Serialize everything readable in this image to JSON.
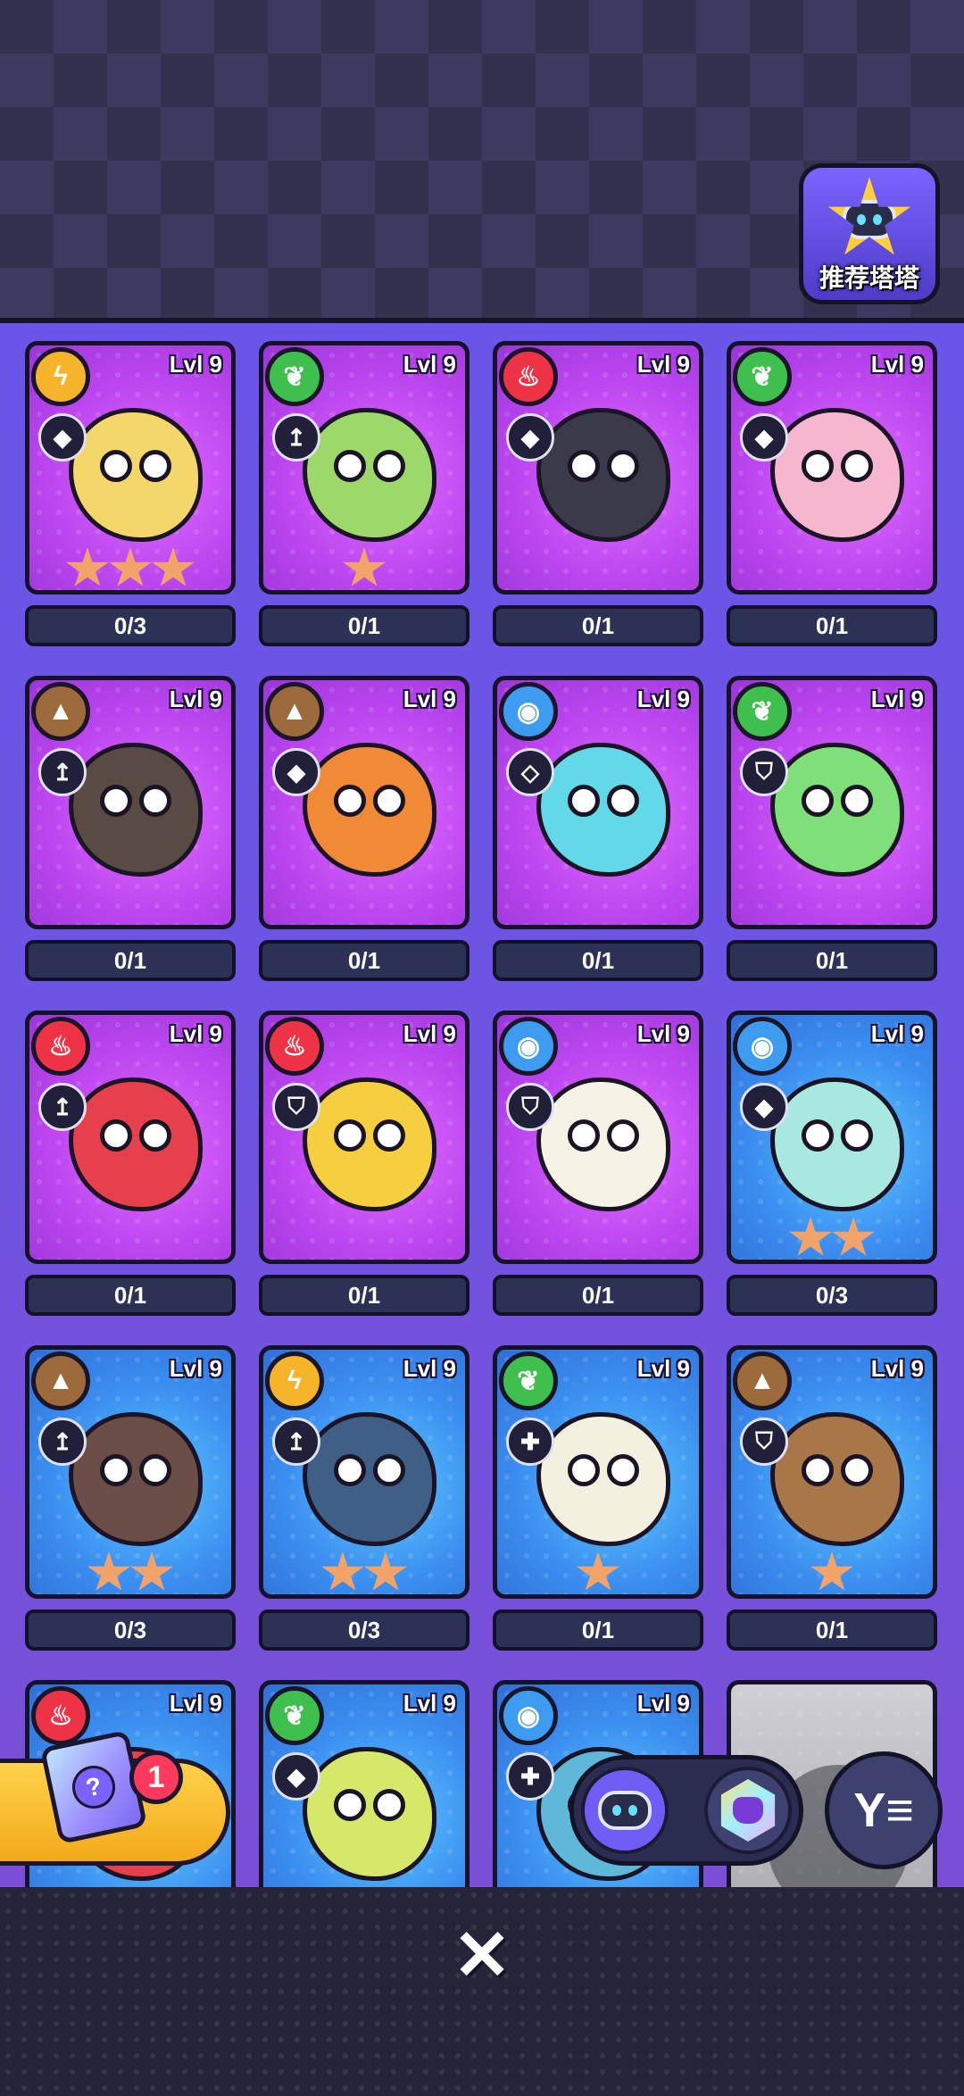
{
  "header": {
    "recommend_label": "推荐塔塔"
  },
  "cards": [
    {
      "level": "Lvl 9",
      "element": "electric",
      "role": "◆",
      "progress": "0/3",
      "stars": 3,
      "bg": "purple",
      "body": "#f5d66a"
    },
    {
      "level": "Lvl 9",
      "element": "grass",
      "role": "↥",
      "progress": "0/1",
      "stars": 1,
      "bg": "purple",
      "body": "#9fd86a"
    },
    {
      "level": "Lvl 9",
      "element": "fire",
      "role": "◆",
      "progress": "0/1",
      "stars": 0,
      "bg": "purple",
      "body": "#3a3a4a"
    },
    {
      "level": "Lvl 9",
      "element": "grass",
      "role": "◆",
      "progress": "0/1",
      "stars": 0,
      "bg": "purple",
      "body": "#f7b6cf"
    },
    {
      "level": "Lvl 9",
      "element": "ground",
      "role": "↥",
      "progress": "0/1",
      "stars": 0,
      "bg": "purple",
      "body": "#5a4a44"
    },
    {
      "level": "Lvl 9",
      "element": "ground",
      "role": "◆",
      "progress": "0/1",
      "stars": 0,
      "bg": "purple",
      "body": "#f08a36"
    },
    {
      "level": "Lvl 9",
      "element": "water",
      "role": "◇",
      "progress": "0/1",
      "stars": 0,
      "bg": "purple",
      "body": "#62d8e8"
    },
    {
      "level": "Lvl 9",
      "element": "grass",
      "role": "⛉",
      "progress": "0/1",
      "stars": 0,
      "bg": "purple",
      "body": "#7fe07a"
    },
    {
      "level": "Lvl 9",
      "element": "fire",
      "role": "↥",
      "progress": "0/1",
      "stars": 0,
      "bg": "purple",
      "body": "#e6404c"
    },
    {
      "level": "Lvl 9",
      "element": "fire",
      "role": "⛉",
      "progress": "0/1",
      "stars": 0,
      "bg": "purple",
      "body": "#f6cf3e"
    },
    {
      "level": "Lvl 9",
      "element": "water",
      "role": "⛉",
      "progress": "0/1",
      "stars": 0,
      "bg": "purple",
      "body": "#f6f2e6"
    },
    {
      "level": "Lvl 9",
      "element": "water",
      "role": "◆",
      "progress": "0/3",
      "stars": 2,
      "bg": "blue",
      "body": "#a8e8e0"
    },
    {
      "level": "Lvl 9",
      "element": "ground",
      "role": "↥",
      "progress": "0/3",
      "stars": 2,
      "bg": "blue",
      "body": "#6b4e48"
    },
    {
      "level": "Lvl 9",
      "element": "electric",
      "role": "↥",
      "progress": "0/3",
      "stars": 2,
      "bg": "blue",
      "body": "#3f5f86"
    },
    {
      "level": "Lvl 9",
      "element": "grass",
      "role": "✚",
      "progress": "0/1",
      "stars": 1,
      "bg": "blue",
      "body": "#f3f0e0"
    },
    {
      "level": "Lvl 9",
      "element": "ground",
      "role": "⛉",
      "progress": "0/1",
      "stars": 1,
      "bg": "blue",
      "body": "#a9764a"
    },
    {
      "level": "Lvl 9",
      "element": "fire",
      "role": "↥",
      "progress": "",
      "stars": 0,
      "bg": "blue",
      "body": "#e6404c"
    },
    {
      "level": "Lvl 9",
      "element": "grass",
      "role": "◆",
      "progress": "",
      "stars": 0,
      "bg": "blue",
      "body": "#d6e86a"
    },
    {
      "level": "Lvl 9",
      "element": "water",
      "role": "✚",
      "progress": "",
      "stars": 0,
      "bg": "blue",
      "body": "#5fb8d8"
    },
    {
      "level": "",
      "element": "",
      "role": "",
      "progress": "",
      "stars": 0,
      "bg": "gray",
      "body": ""
    }
  ],
  "element_icons": {
    "electric": "ϟ",
    "grass": "❦",
    "fire": "♨",
    "ground": "▲",
    "water": "◉"
  },
  "bottom": {
    "box_count": "1",
    "box_icon_text": "?",
    "filter_icon": "Y≡",
    "close_icon": "✕"
  },
  "colors": {
    "accent": "#6f5df5",
    "card_purple": "#bd46f0",
    "card_blue": "#3b8ef0",
    "badge_red": "#ff3a5c",
    "gold": "#f3a91a"
  }
}
